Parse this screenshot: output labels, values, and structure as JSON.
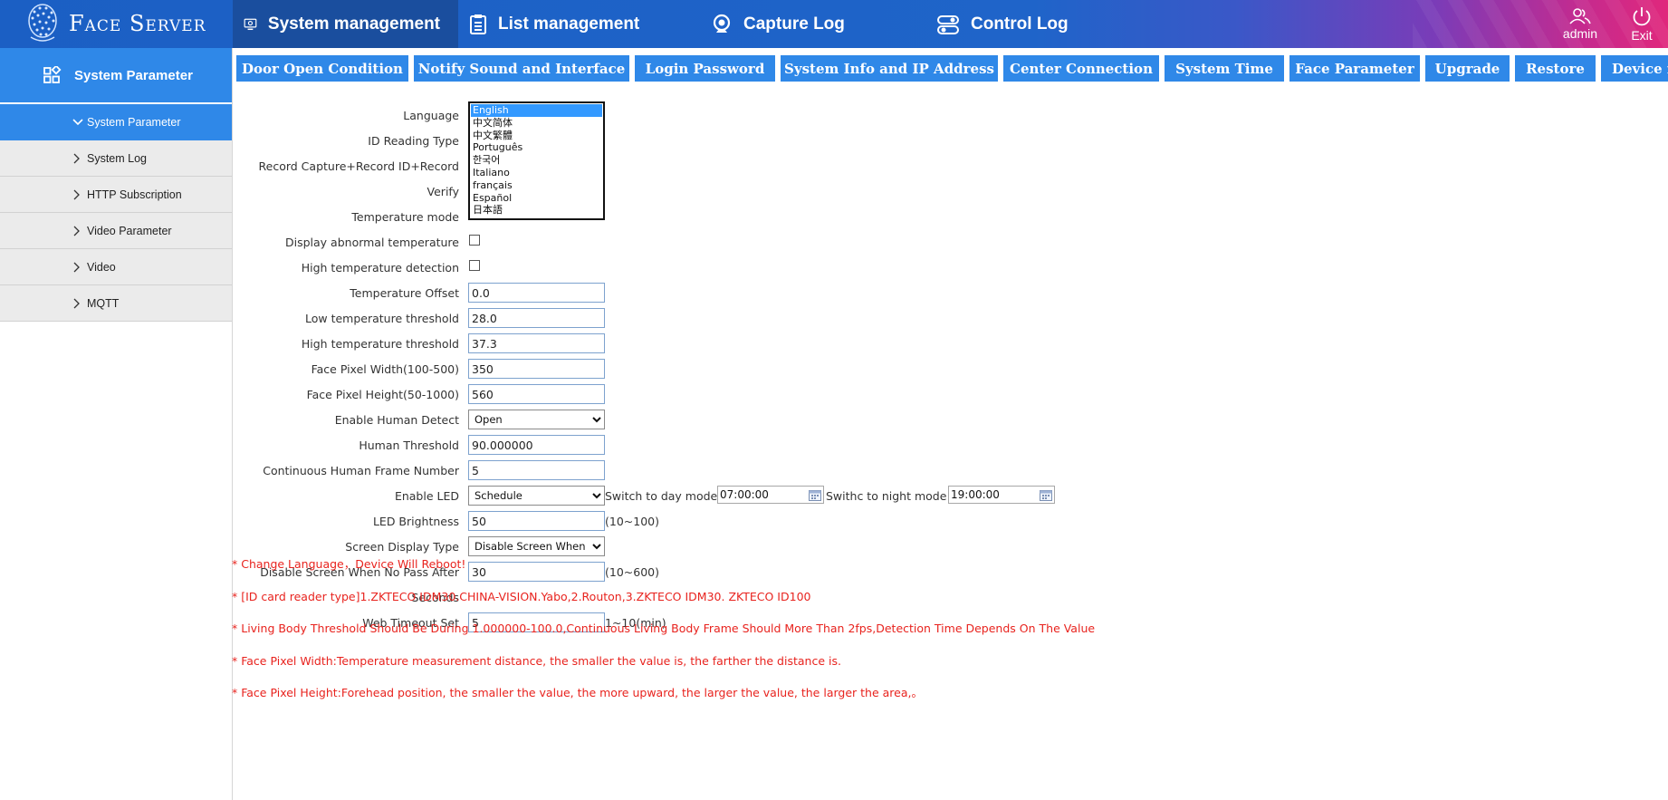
{
  "app": {
    "logo_text": "Face Server"
  },
  "topnav": {
    "items": [
      {
        "label": "System management",
        "icon": "monitor-gear-icon",
        "active": true
      },
      {
        "label": "List management",
        "icon": "list-clipboard-icon",
        "active": false
      },
      {
        "label": "Capture Log",
        "icon": "camera-icon",
        "active": false
      },
      {
        "label": "Control Log",
        "icon": "toggle-switch-icon",
        "active": false
      }
    ],
    "user_label": "admin",
    "exit_label": "Exit"
  },
  "sidebar": {
    "header": "System Parameter",
    "items": [
      {
        "label": "System Parameter",
        "active": true,
        "expanded": true
      },
      {
        "label": "System Log",
        "active": false
      },
      {
        "label": "HTTP Subscription",
        "active": false
      },
      {
        "label": "Video Parameter",
        "active": false
      },
      {
        "label": "Video",
        "active": false
      },
      {
        "label": "MQTT",
        "active": false
      }
    ]
  },
  "tabs": [
    "Door Open Condition",
    "Notify Sound and Interface",
    "Login Password",
    "System Info and IP Address",
    "Center Connection",
    "System Time",
    "Face Parameter",
    "Upgrade",
    "Restore",
    "Device m"
  ],
  "form": {
    "language": {
      "label": "Language",
      "options": [
        "English",
        "中文简体",
        "中文繁體",
        "Português",
        "한국어",
        "Italiano",
        "français",
        "Español",
        "日本語"
      ],
      "selected": "English"
    },
    "id_reading_type": {
      "label": "ID Reading Type"
    },
    "record_capture": {
      "label": "Record Capture+Record ID+Record"
    },
    "verify": {
      "label": "Verify"
    },
    "temperature_mode": {
      "label": "Temperature mode"
    },
    "display_abnormal_temperature": {
      "label": "Display abnormal temperature",
      "checked": false
    },
    "high_temperature_detection": {
      "label": "High temperature detection",
      "checked": false
    },
    "temperature_offset": {
      "label": "Temperature Offset",
      "value": "0.0"
    },
    "low_temperature_threshold": {
      "label": "Low temperature threshold",
      "value": "28.0"
    },
    "high_temperature_threshold": {
      "label": "High temperature threshold",
      "value": "37.3"
    },
    "face_pixel_width": {
      "label": "Face Pixel Width(100-500)",
      "value": "350"
    },
    "face_pixel_height": {
      "label": "Face Pixel Height(50-1000)",
      "value": "560"
    },
    "enable_human_detect": {
      "label": "Enable Human Detect",
      "value": "Open"
    },
    "human_threshold": {
      "label": "Human Threshold",
      "value": "90.000000"
    },
    "continuous_human_frame": {
      "label": "Continuous Human Frame Number",
      "value": "5"
    },
    "enable_led": {
      "label": "Enable LED",
      "value": "Schedule",
      "day_label": "Switch to day mode",
      "day_value": "07:00:00",
      "night_label": "Swithc to night mode",
      "night_value": "19:00:00"
    },
    "led_brightness": {
      "label": "LED Brightness",
      "value": "50",
      "hint": "(10~100)"
    },
    "screen_display_type": {
      "label": "Screen Display Type",
      "value": "Disable Screen When No Pass"
    },
    "disable_screen_after": {
      "label": "Disable Screen When No Pass After",
      "value": "30",
      "hint": "(10~600)"
    },
    "seconds": {
      "label": "Seconds"
    },
    "web_timeout": {
      "label": "Web Timeout Set",
      "value": "5",
      "hint": "1~10(min)"
    }
  },
  "notes": [
    "* Change Language，Device Will Reboot!",
    "* [ID card reader type]1.ZKTECO IDM30.CHINA-VISION.Yabo,2.Routon,3.ZKTECO IDM30. ZKTECO ID100",
    "* Living Body Threshold Should Be During 1.000000-100.0,Continuous Living Body Frame Should More Than 2fps,Detection Time Depends On The Value",
    "* Face Pixel Width:Temperature measurement distance, the smaller the value is, the farther the distance is.",
    "* Face Pixel Height:Forehead position, the smaller the value, the more upward, the larger the value, the larger the area,。"
  ]
}
